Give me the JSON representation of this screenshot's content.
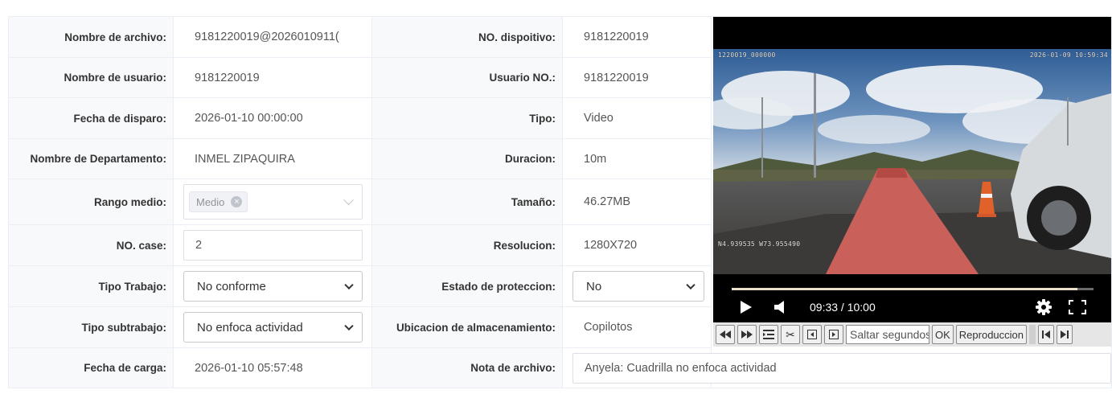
{
  "fields": {
    "file_name": {
      "label": "Nombre de archivo:",
      "value": "9181220019@2026010911("
    },
    "device_no": {
      "label": "NO. dispoitivo:",
      "value": "9181220019"
    },
    "user_name": {
      "label": "Nombre de usuario:",
      "value": "9181220019"
    },
    "user_no": {
      "label": "Usuario NO.:",
      "value": "9181220019"
    },
    "trigger_date": {
      "label": "Fecha de disparo:",
      "value": "2026-01-10 00:00:00"
    },
    "type": {
      "label": "Tipo:",
      "value": "Video"
    },
    "department": {
      "label": "Nombre de Departamento:",
      "value": "INMEL ZIPAQUIRA"
    },
    "duration": {
      "label": "Duracion:",
      "value": "10m"
    },
    "range": {
      "label": "Rango medio:",
      "tag": "Medio"
    },
    "size": {
      "label": "Tamaño:",
      "value": "46.27MB"
    },
    "case_no": {
      "label": "NO. case:",
      "value": "2"
    },
    "resolution": {
      "label": "Resolucion:",
      "value": "1280X720"
    },
    "work_type": {
      "label": "Tipo Trabajo:",
      "selected": "No conforme"
    },
    "protection": {
      "label": "Estado de proteccion:",
      "selected": "No"
    },
    "sub_work_type": {
      "label": "Tipo subtrabajo:",
      "selected": "No enfoca actividad"
    },
    "storage": {
      "label": "Ubicacion de almacenamiento:",
      "value": "Copilotos"
    },
    "upload_date": {
      "label": "Fecha de carga:",
      "value": "2026-01-10 05:57:48"
    },
    "file_note": {
      "label": "Nota de archivo:",
      "value": "Anyela: Cuadrilla no enfoca actividad"
    }
  },
  "player": {
    "osd_id": "1220019_000000",
    "osd_datetime": "2026-01-09 10:59:34",
    "osd_coords": "N4.939535  W73.955490",
    "time": "09:33 / 10:00",
    "progress": 0.955,
    "icons": [
      "play-icon",
      "volume-icon",
      "settings-icon",
      "fullscreen-icon"
    ]
  },
  "toolbar": {
    "seek_placeholder": "Saltar segundos",
    "ok_label": "OK",
    "playback_label": "Reproduccion",
    "icons": [
      "rewind-icon",
      "fast-forward-icon",
      "list-icon",
      "scissors-icon",
      "frame-back-icon",
      "frame-forward-icon",
      "skip-start-icon",
      "skip-end-icon"
    ]
  },
  "colors": {
    "border": "#ebeef5",
    "label_bg": "#f8f9fb",
    "progress": "#e9dfc8"
  }
}
